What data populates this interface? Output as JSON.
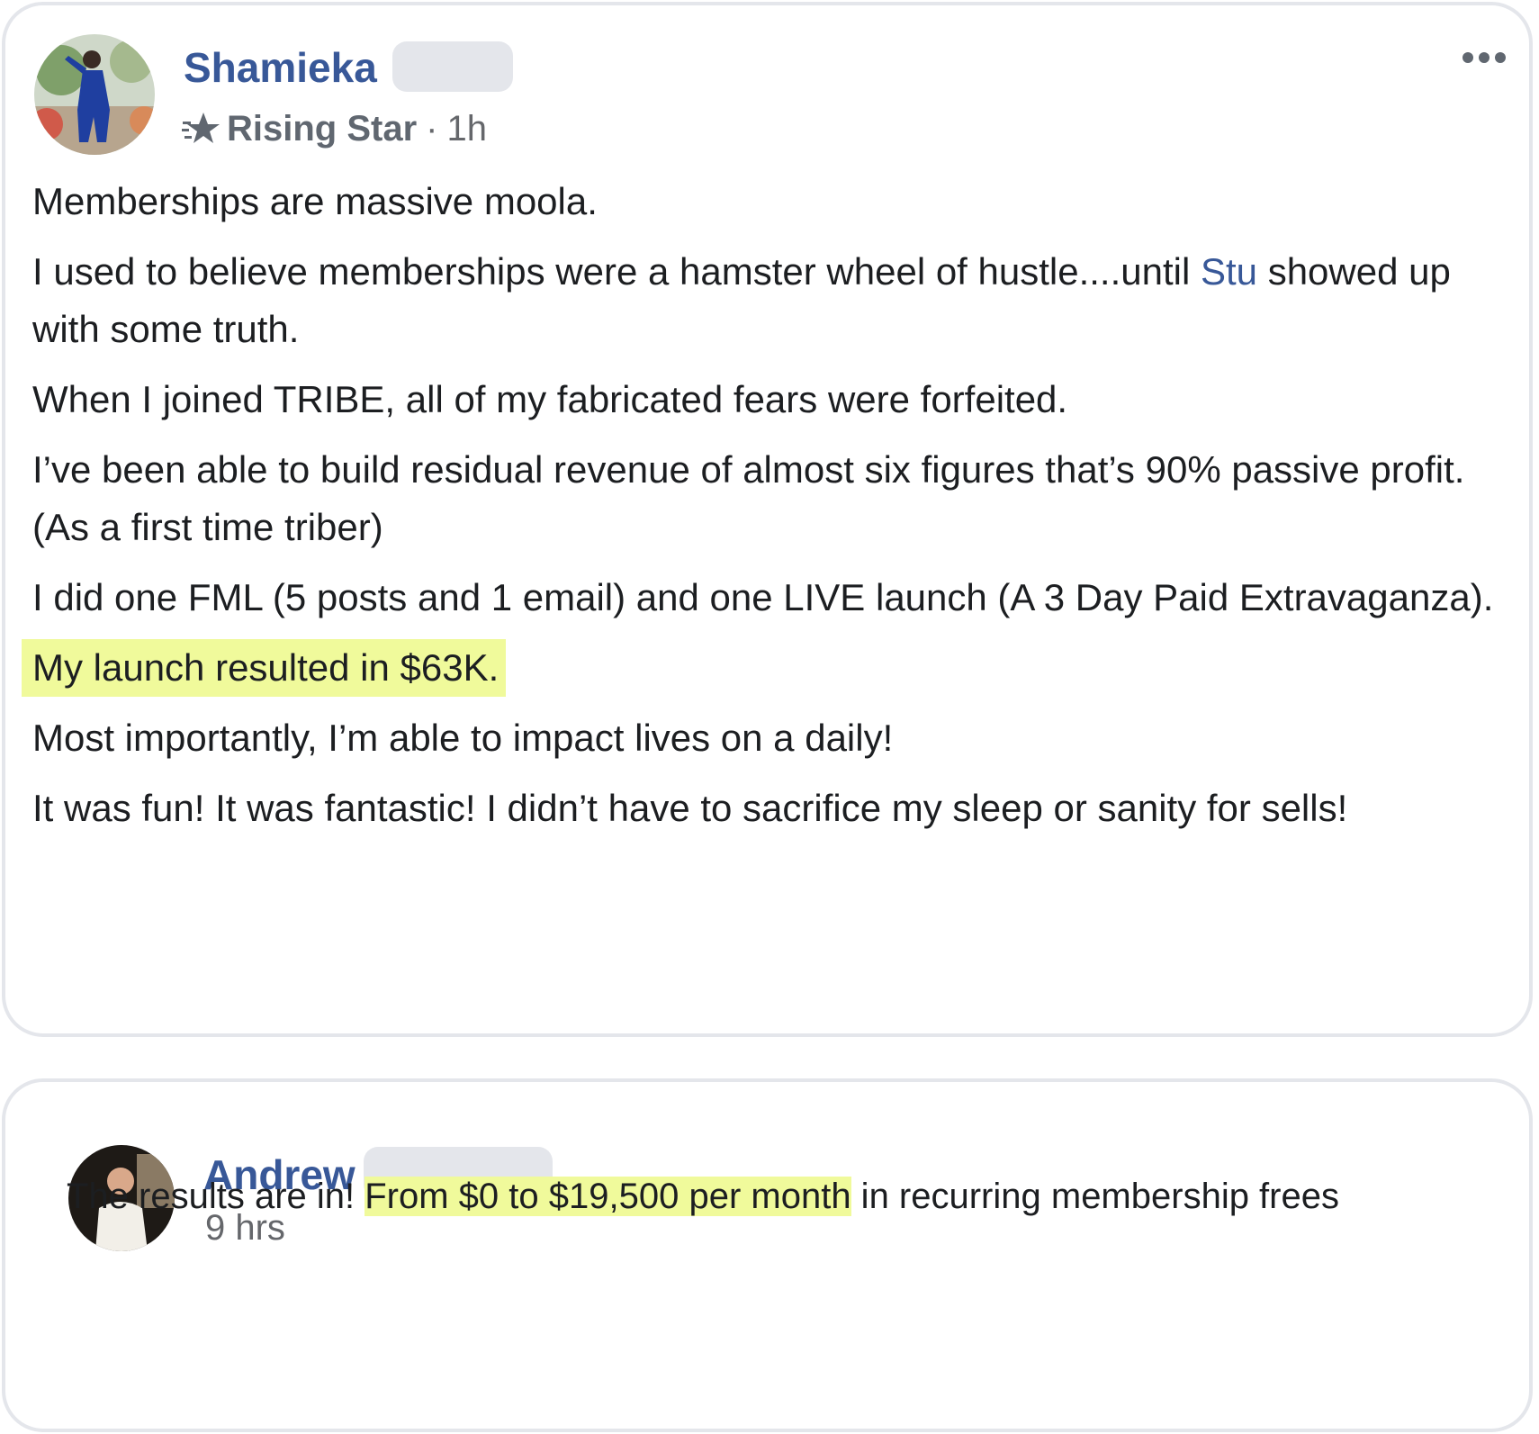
{
  "post": {
    "author_name": "Shamieka",
    "badge_label": "Rising Star",
    "separator": "·",
    "timestamp": "1h",
    "more_icon": "ellipsis-icon",
    "badge_icon": "rising-star-icon",
    "paragraphs": {
      "p1": "Memberships are massive moola.",
      "p2_before": "I used to believe memberships were a hamster wheel of hustle....until ",
      "p2_mention": "Stu",
      "p2_after": " showed up with some truth.",
      "p3": "When I joined TRIBE, all of my fabricated fears were forfeited.",
      "p4": "I’ve been able to build residual revenue of almost six figures that’s 90% passive profit. (As a first time triber)",
      "p5": "I did one FML (5 posts and 1 email) and one LIVE launch (A 3 Day Paid Extravaganza).",
      "p6_highlight": "My launch resulted in $63K.",
      "p7": "Most importantly, I’m able to impact lives on a daily!",
      "p8": "It was fun! It was fantastic! I didn’t have to sacrifice my sleep or sanity for sells!"
    }
  },
  "comment": {
    "author_name": "Andrew",
    "timestamp": "9 hrs",
    "text_before": "The results are in! ",
    "text_highlight": "From $0 to $19,500 per month",
    "text_after": " in recurring membership frees"
  },
  "colors": {
    "name_link": "#385898",
    "meta_gray": "#65676b",
    "highlight": "#f0fa9b",
    "card_border": "#e4e6eb"
  }
}
